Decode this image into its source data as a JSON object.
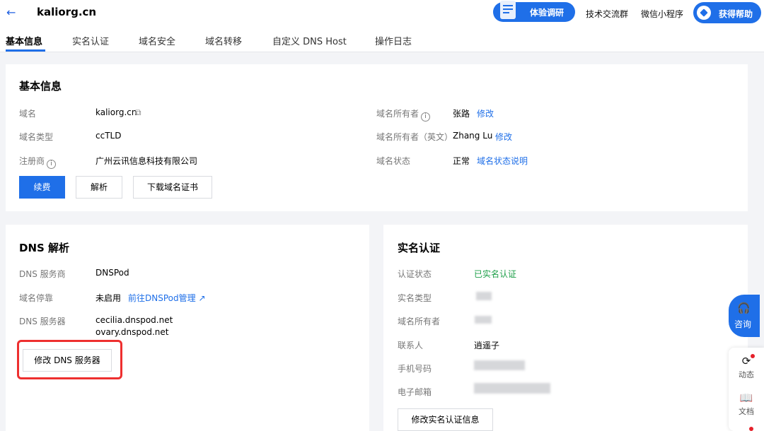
{
  "header": {
    "back_icon": "←",
    "domain": "kaliorg.cn",
    "survey_label": "体验调研",
    "links": [
      "技术交流群",
      "微信小程序"
    ],
    "help_label": "获得帮助"
  },
  "tabs": [
    "基本信息",
    "实名认证",
    "域名安全",
    "域名转移",
    "自定义 DNS Host",
    "操作日志"
  ],
  "basic": {
    "title": "基本信息",
    "domain_label": "域名",
    "domain_value": "kaliorg.cn",
    "copy_icon": "⧉",
    "type_label": "域名类型",
    "type_value": "ccTLD",
    "registrar_label": "注册商",
    "registrar_value": "广州云讯信息科技有限公司",
    "owner_label": "域名所有者",
    "owner_value": "张路",
    "owner_edit": "修改",
    "owner_en_label": "域名所有者（英文）",
    "owner_en_value": "Zhang Lu",
    "owner_en_edit": "修改",
    "status_label": "域名状态",
    "status_value": "正常",
    "status_link": "域名状态说明",
    "info_icon": "i",
    "buttons": {
      "renew": "续费",
      "resolve": "解析",
      "download": "下载域名证书"
    }
  },
  "dns": {
    "title": "DNS 解析",
    "provider_label": "DNS 服务商",
    "provider_value": "DNSPod",
    "parking_label": "域名停靠",
    "parking_value": "未启用",
    "parking_link": "前往DNSPod管理",
    "external_icon": "↗",
    "servers_label": "DNS 服务器",
    "servers": [
      "cecilia.dnspod.net",
      "ovary.dnspod.net"
    ],
    "modify_button": "修改 DNS 服务器"
  },
  "realname": {
    "title": "实名认证",
    "status_label": "认证状态",
    "status_value": "已实名认证",
    "type_label": "实名类型",
    "owner_label": "域名所有者",
    "contact_label": "联系人",
    "contact_value": "逍遥子",
    "phone_label": "手机号码",
    "email_label": "电子邮箱",
    "modify_button": "修改实名认证信息"
  },
  "side": {
    "consult_icon": "🎧",
    "consult_label": "咨询",
    "dynamic_icon": "⟳",
    "dynamic_label": "动态",
    "docs_icon": "📖",
    "docs_label": "文档"
  },
  "colors": {
    "primary": "#1f6fe8",
    "success": "#1fa04a",
    "highlight": "#ee2f2f"
  }
}
